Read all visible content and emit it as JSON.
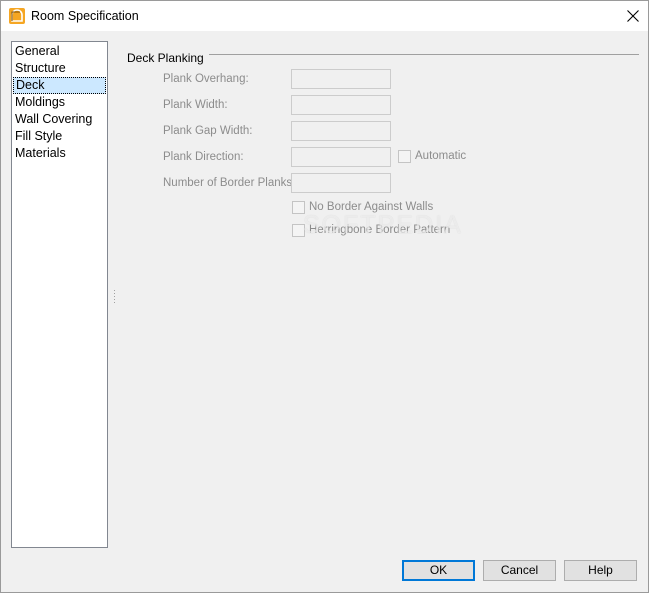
{
  "window": {
    "title": "Room Specification"
  },
  "nav": {
    "items": [
      {
        "label": "General"
      },
      {
        "label": "Structure"
      },
      {
        "label": "Deck"
      },
      {
        "label": "Moldings"
      },
      {
        "label": "Wall Covering"
      },
      {
        "label": "Fill Style"
      },
      {
        "label": "Materials"
      }
    ],
    "selected": "Deck"
  },
  "deck_planking": {
    "group_title": "Deck Planking",
    "fields": {
      "plank_overhang": {
        "label": "Plank Overhang:",
        "value": ""
      },
      "plank_width": {
        "label": "Plank Width:",
        "value": ""
      },
      "plank_gap_width": {
        "label": "Plank Gap Width:",
        "value": ""
      },
      "plank_direction": {
        "label": "Plank Direction:",
        "value": ""
      },
      "border_planks": {
        "label": "Number of Border Planks:",
        "value": ""
      }
    },
    "automatic": {
      "label": "Automatic",
      "checked": false
    },
    "no_border": {
      "label": "No Border Against Walls",
      "checked": false
    },
    "herringbone": {
      "label": "Herringbone Border Pattern",
      "checked": false
    }
  },
  "watermark": {
    "text": "SOFTPEDIA"
  },
  "buttons": {
    "ok": "OK",
    "cancel": "Cancel",
    "help": "Help"
  },
  "colors": {
    "accent": "#0078d7",
    "selection": "#cce8ff",
    "app_icon": "#f5a623"
  },
  "icons": {
    "app": "room-spec-app-icon",
    "close": "close-icon"
  }
}
